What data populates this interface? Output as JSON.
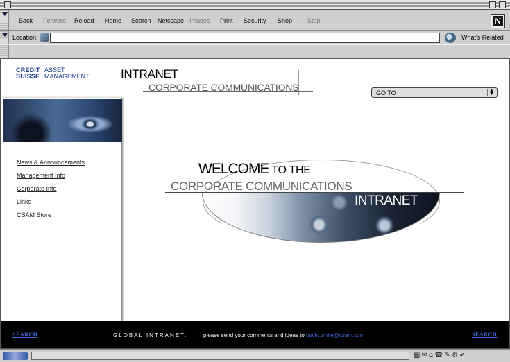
{
  "toolbar": {
    "back": "Back",
    "forward": "Forward",
    "reload": "Reload",
    "home": "Home",
    "search": "Search",
    "netscape": "Netscape",
    "images": "Images",
    "print": "Print",
    "security": "Security",
    "shop": "Shop",
    "stop": "Stop",
    "logo": "N"
  },
  "location": {
    "label": "Location:",
    "value": "",
    "related": "What's Related"
  },
  "header": {
    "logo_credit": "CREDIT",
    "logo_suisse": "SUISSE",
    "logo_asset": "ASSET",
    "logo_management": "MANAGEMENT",
    "title": "INTRANET",
    "subtitle": "CORPORATE COMMUNICATIONS",
    "goto": "GO TO"
  },
  "nav": {
    "items": [
      "News & Announcements",
      "Management Info",
      "Corporate Info",
      "Links",
      "CSAM Store"
    ]
  },
  "main": {
    "welcome": "WELCOME",
    "to_the": " TO THE",
    "corp": "CORPORATE COMMUNICATIONS",
    "intranet": "INTRANET"
  },
  "footer": {
    "search_left": "SEARCH",
    "global": "GLOBAL INTRANET:",
    "message": "please send your comments and ideas to ",
    "email": "osvin.white@csam.com",
    "search_right": "SEARCH"
  }
}
